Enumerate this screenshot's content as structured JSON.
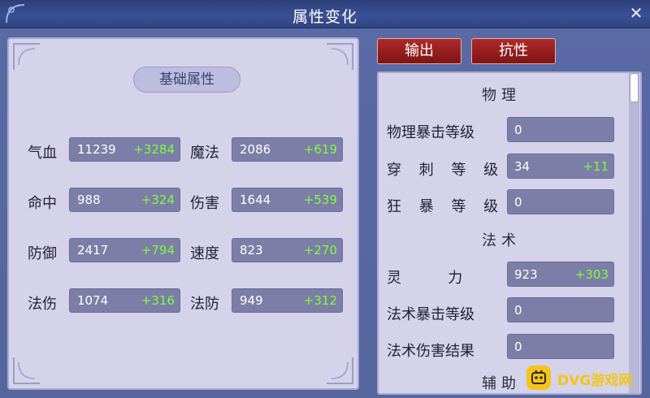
{
  "window": {
    "title": "属性变化"
  },
  "tabs": [
    {
      "label": "输出"
    },
    {
      "label": "抗性"
    }
  ],
  "basic": {
    "section_title": "基础属性",
    "rows": [
      {
        "label": "气血",
        "value": "11239",
        "bonus": "+3284"
      },
      {
        "label": "魔法",
        "value": "2086",
        "bonus": "+619"
      },
      {
        "label": "命中",
        "value": "988",
        "bonus": "+324"
      },
      {
        "label": "伤害",
        "value": "1644",
        "bonus": "+539"
      },
      {
        "label": "防御",
        "value": "2417",
        "bonus": "+794"
      },
      {
        "label": "速度",
        "value": "823",
        "bonus": "+270"
      },
      {
        "label": "法伤",
        "value": "1074",
        "bonus": "+316"
      },
      {
        "label": "法防",
        "value": "949",
        "bonus": "+312"
      }
    ]
  },
  "output": {
    "physical": {
      "heading": "物理",
      "rows": [
        {
          "label": "物理暴击等级",
          "value": "0",
          "bonus": ""
        },
        {
          "label": "穿 刺 等 级",
          "value": "34",
          "bonus": "+11"
        },
        {
          "label": "狂 暴 等 级",
          "value": "0",
          "bonus": ""
        }
      ]
    },
    "magic": {
      "heading": "法术",
      "rows": [
        {
          "label": "灵          力",
          "value": "923",
          "bonus": "+303"
        },
        {
          "label": "法术暴击等级",
          "value": "0",
          "bonus": ""
        },
        {
          "label": "法术伤害结果",
          "value": "0",
          "bonus": ""
        }
      ]
    },
    "support": {
      "heading": "辅助"
    }
  },
  "watermark": {
    "text": "DVG游戏网"
  },
  "colors": {
    "bonus_green": "#7aff3e",
    "tab_red": "#9a1c1c",
    "panel_bg": "#d4d3ea",
    "value_box": "#7d7ea7"
  }
}
